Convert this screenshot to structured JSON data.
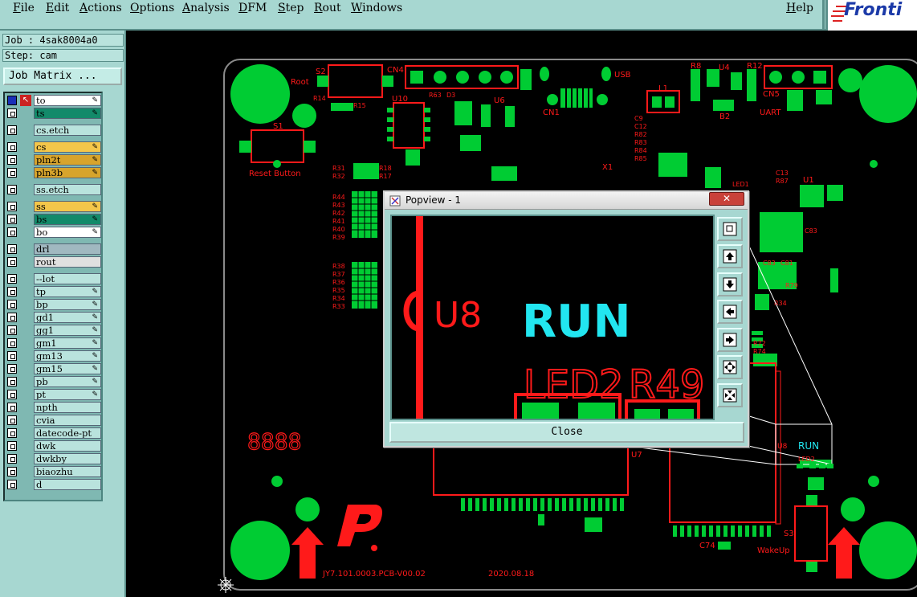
{
  "menu": [
    "File",
    "Edit",
    "Actions",
    "Options",
    "Analysis",
    "DFM",
    "Step",
    "Rout",
    "Windows"
  ],
  "help_label": "Help",
  "logo_text": "Fronti",
  "job_label": "Job : 4sak8004a0",
  "step_label": "Step: cam",
  "job_matrix_label": "Job Matrix ...",
  "layers": [
    {
      "name": "to",
      "color": "#ffffff",
      "edit": true
    },
    {
      "name": "ts",
      "color": "#138a6a",
      "edit": true
    },
    {
      "name": "cs.etch",
      "color": "#b9e3dd",
      "edit": false
    },
    {
      "name": "cs",
      "color": "#f4c64a",
      "edit": true
    },
    {
      "name": "pln2t",
      "color": "#d7a42c",
      "edit": true
    },
    {
      "name": "pln3b",
      "color": "#d7a42c",
      "edit": true
    },
    {
      "name": "ss.etch",
      "color": "#b9e3dd",
      "edit": false
    },
    {
      "name": "ss",
      "color": "#f4c64a",
      "edit": true
    },
    {
      "name": "bs",
      "color": "#138a6a",
      "edit": true
    },
    {
      "name": "bo",
      "color": "#ffffff",
      "edit": true
    },
    {
      "name": "drl",
      "color": "#a0b8c0",
      "edit": false
    },
    {
      "name": "rout",
      "color": "#e0e0e0",
      "edit": false
    },
    {
      "name": "--lot",
      "color": "#b9e3dd",
      "edit": false
    },
    {
      "name": "tp",
      "color": "#b9e3dd",
      "edit": true
    },
    {
      "name": "bp",
      "color": "#b9e3dd",
      "edit": true
    },
    {
      "name": "gd1",
      "color": "#b9e3dd",
      "edit": true
    },
    {
      "name": "gg1",
      "color": "#b9e3dd",
      "edit": true
    },
    {
      "name": "gm1",
      "color": "#b9e3dd",
      "edit": true
    },
    {
      "name": "gm13",
      "color": "#b9e3dd",
      "edit": true
    },
    {
      "name": "gm15",
      "color": "#b9e3dd",
      "edit": true
    },
    {
      "name": "pb",
      "color": "#b9e3dd",
      "edit": true
    },
    {
      "name": "pt",
      "color": "#b9e3dd",
      "edit": true
    },
    {
      "name": "npth",
      "color": "#b9e3dd",
      "edit": false
    },
    {
      "name": "cvia",
      "color": "#b9e3dd",
      "edit": false
    },
    {
      "name": "datecode-pt",
      "color": "#b9e3dd",
      "edit": false
    },
    {
      "name": "dwk",
      "color": "#b9e3dd",
      "edit": false
    },
    {
      "name": "dwkby",
      "color": "#b9e3dd",
      "edit": false
    },
    {
      "name": "biaozhu",
      "color": "#b9e3dd",
      "edit": false
    },
    {
      "name": "d",
      "color": "#b9e3dd",
      "edit": false
    }
  ],
  "popview": {
    "title": "Popview - 1",
    "close_label": "Close",
    "x_label": "✕",
    "view_labels": {
      "u8": "U8",
      "run": "RUN",
      "led2": "LED2",
      "r49": "R49"
    }
  },
  "pcb": {
    "silk": {
      "reset": "Reset Button",
      "root": "Root",
      "usb": "USB",
      "uart": "UART",
      "wakeup": "WakeUp",
      "part_no": "JY7.101.0003.PCB-V00.02",
      "date": "2020.08.18",
      "datecode": "8888",
      "s2": "S2",
      "cn4": "CN4",
      "s1": "S1",
      "u4": "U4",
      "cn5": "CN5",
      "l1": "L1",
      "u1": "U1",
      "s3": "S3",
      "u6": "U6",
      "u10": "U10",
      "u7": "U7",
      "x1": "X1",
      "cn1": "CN1",
      "c74": "C74",
      "led1": "LED1",
      "u2": "U2",
      "r8": "R8",
      "r12": "R12",
      "b2": "B2"
    }
  },
  "colors": {
    "panel": "#a7d7d1",
    "copper": "#00cc33",
    "silk": "#ff1a1a",
    "run": "#22e6f0",
    "outline": "#8a8a8a"
  }
}
